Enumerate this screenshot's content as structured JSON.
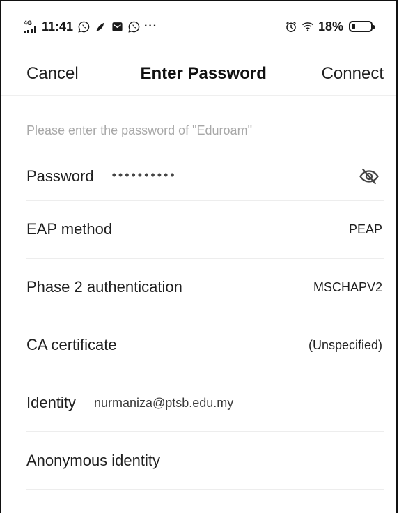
{
  "status_bar": {
    "network": "4G",
    "time": "11:41",
    "notifications": [
      "whatsapp-icon",
      "maps-icon",
      "mail-icon",
      "whatsapp-icon"
    ],
    "more_indicator": "···",
    "battery_percent": "18%",
    "battery_level": 0.18
  },
  "header": {
    "cancel_label": "Cancel",
    "title": "Enter Password",
    "connect_label": "Connect"
  },
  "form": {
    "hint": "Please enter the password of \"Eduroam\"",
    "password": {
      "label": "Password",
      "value": "••••••••••",
      "toggle_icon": "eye-off-icon"
    },
    "eap_method": {
      "label": "EAP method",
      "value": "PEAP"
    },
    "phase2": {
      "label": "Phase 2 authentication",
      "value": "MSCHAPV2"
    },
    "ca_certificate": {
      "label": "CA certificate",
      "value": "(Unspecified)"
    },
    "identity": {
      "label": "Identity",
      "value": "nurmaniza@ptsb.edu.my"
    },
    "anonymous_identity": {
      "label": "Anonymous identity",
      "value": ""
    }
  },
  "colors": {
    "text_primary": "#1f1f1f",
    "hint_text": "#a8a8a8",
    "divider": "#ededed"
  }
}
